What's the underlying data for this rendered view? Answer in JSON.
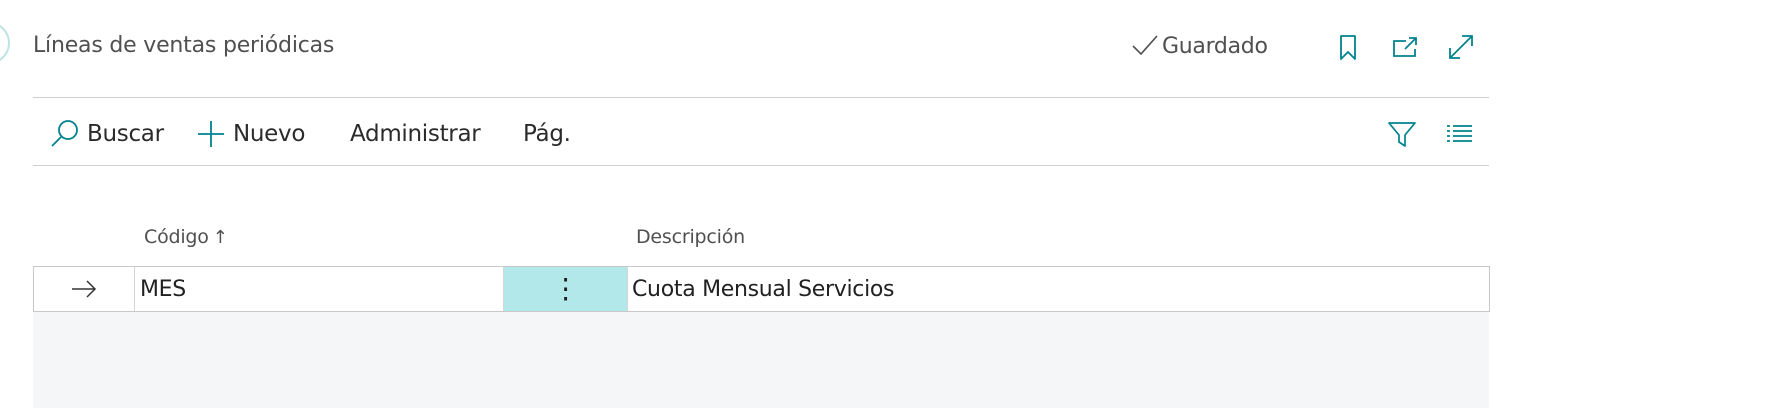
{
  "header": {
    "title": "Líneas de ventas periódicas",
    "saved_label": "Guardado",
    "icons": [
      "checkmark-icon",
      "bookmark-icon",
      "open-new-window-icon",
      "expand-icon"
    ]
  },
  "action_bar": {
    "search_label": "Buscar",
    "new_label": "Nuevo",
    "manage_label": "Administrar",
    "page_label": "Pág.",
    "icons": [
      "search-icon",
      "plus-icon",
      "filter-icon",
      "list-view-icon"
    ]
  },
  "table": {
    "columns": [
      {
        "label": "Código",
        "sort": "↑"
      },
      {
        "label": "Descripción"
      }
    ],
    "rows": [
      {
        "indicator": "→",
        "code": "MES",
        "menu": "⋮",
        "description": "Cuota Mensual Servicios"
      }
    ]
  },
  "colors": {
    "accent": "#00838f",
    "selected_cell": "#b3e8ea",
    "empty_area": "#f5f6f7",
    "divider": "#d0d0d0"
  }
}
